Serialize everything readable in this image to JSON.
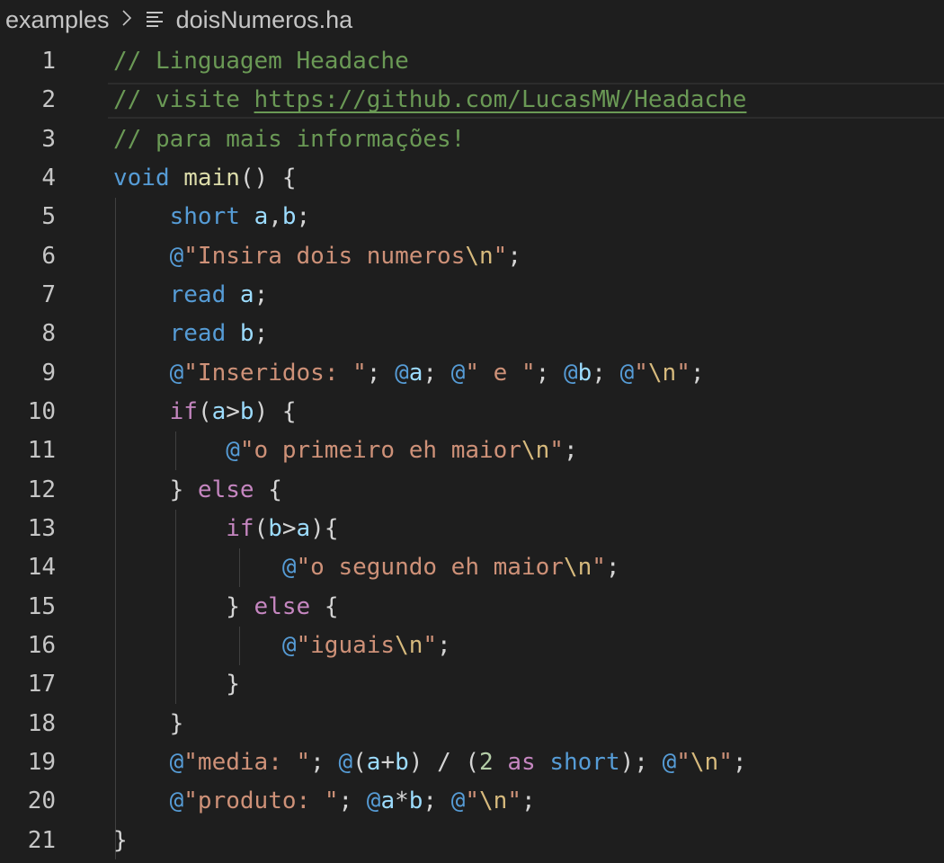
{
  "breadcrumb": {
    "folder": "examples",
    "separator": ">",
    "file_icon": "lines-file-icon",
    "file": "doisNumeros.ha"
  },
  "editor": {
    "current_line": 2,
    "lines": [
      {
        "n": "1",
        "tokens": [
          {
            "t": "// Linguagem Headache",
            "c": "comment"
          }
        ]
      },
      {
        "n": "2",
        "tokens": [
          {
            "t": "// visite ",
            "c": "comment"
          },
          {
            "t": "https://github.com/LucasMW/Headache",
            "c": "link"
          }
        ]
      },
      {
        "n": "3",
        "tokens": [
          {
            "t": "// para mais informações!",
            "c": "comment"
          }
        ]
      },
      {
        "n": "4",
        "tokens": [
          {
            "t": "void",
            "c": "keyword"
          },
          {
            "t": " ",
            "c": "punct"
          },
          {
            "t": "main",
            "c": "function"
          },
          {
            "t": "() {",
            "c": "punct"
          }
        ]
      },
      {
        "n": "5",
        "tokens": [
          {
            "t": "    ",
            "c": "punct"
          },
          {
            "t": "short",
            "c": "keyword"
          },
          {
            "t": " ",
            "c": "punct"
          },
          {
            "t": "a",
            "c": "var"
          },
          {
            "t": ",",
            "c": "punct"
          },
          {
            "t": "b",
            "c": "var"
          },
          {
            "t": ";",
            "c": "punct"
          }
        ]
      },
      {
        "n": "6",
        "tokens": [
          {
            "t": "    ",
            "c": "punct"
          },
          {
            "t": "@",
            "c": "at"
          },
          {
            "t": "\"Insira dois numeros",
            "c": "string"
          },
          {
            "t": "\\n",
            "c": "escape"
          },
          {
            "t": "\"",
            "c": "string"
          },
          {
            "t": ";",
            "c": "punct"
          }
        ]
      },
      {
        "n": "7",
        "tokens": [
          {
            "t": "    ",
            "c": "punct"
          },
          {
            "t": "read",
            "c": "keyword"
          },
          {
            "t": " ",
            "c": "punct"
          },
          {
            "t": "a",
            "c": "var"
          },
          {
            "t": ";",
            "c": "punct"
          }
        ]
      },
      {
        "n": "8",
        "tokens": [
          {
            "t": "    ",
            "c": "punct"
          },
          {
            "t": "read",
            "c": "keyword"
          },
          {
            "t": " ",
            "c": "punct"
          },
          {
            "t": "b",
            "c": "var"
          },
          {
            "t": ";",
            "c": "punct"
          }
        ]
      },
      {
        "n": "9",
        "tokens": [
          {
            "t": "    ",
            "c": "punct"
          },
          {
            "t": "@",
            "c": "at"
          },
          {
            "t": "\"Inseridos: \"",
            "c": "string"
          },
          {
            "t": "; ",
            "c": "punct"
          },
          {
            "t": "@",
            "c": "at"
          },
          {
            "t": "a",
            "c": "var"
          },
          {
            "t": "; ",
            "c": "punct"
          },
          {
            "t": "@",
            "c": "at"
          },
          {
            "t": "\" e \"",
            "c": "string"
          },
          {
            "t": "; ",
            "c": "punct"
          },
          {
            "t": "@",
            "c": "at"
          },
          {
            "t": "b",
            "c": "var"
          },
          {
            "t": "; ",
            "c": "punct"
          },
          {
            "t": "@",
            "c": "at"
          },
          {
            "t": "\"",
            "c": "string"
          },
          {
            "t": "\\n",
            "c": "escape"
          },
          {
            "t": "\"",
            "c": "string"
          },
          {
            "t": ";",
            "c": "punct"
          }
        ]
      },
      {
        "n": "10",
        "tokens": [
          {
            "t": "    ",
            "c": "punct"
          },
          {
            "t": "if",
            "c": "control"
          },
          {
            "t": "(",
            "c": "punct"
          },
          {
            "t": "a",
            "c": "var"
          },
          {
            "t": ">",
            "c": "punct"
          },
          {
            "t": "b",
            "c": "var"
          },
          {
            "t": ") {",
            "c": "punct"
          }
        ]
      },
      {
        "n": "11",
        "tokens": [
          {
            "t": "        ",
            "c": "punct"
          },
          {
            "t": "@",
            "c": "at"
          },
          {
            "t": "\"o primeiro eh maior",
            "c": "string"
          },
          {
            "t": "\\n",
            "c": "escape"
          },
          {
            "t": "\"",
            "c": "string"
          },
          {
            "t": ";",
            "c": "punct"
          }
        ]
      },
      {
        "n": "12",
        "tokens": [
          {
            "t": "    } ",
            "c": "punct"
          },
          {
            "t": "else",
            "c": "control"
          },
          {
            "t": " {",
            "c": "punct"
          }
        ]
      },
      {
        "n": "13",
        "tokens": [
          {
            "t": "        ",
            "c": "punct"
          },
          {
            "t": "if",
            "c": "control"
          },
          {
            "t": "(",
            "c": "punct"
          },
          {
            "t": "b",
            "c": "var"
          },
          {
            "t": ">",
            "c": "punct"
          },
          {
            "t": "a",
            "c": "var"
          },
          {
            "t": "){",
            "c": "punct"
          }
        ]
      },
      {
        "n": "14",
        "tokens": [
          {
            "t": "            ",
            "c": "punct"
          },
          {
            "t": "@",
            "c": "at"
          },
          {
            "t": "\"o segundo eh maior",
            "c": "string"
          },
          {
            "t": "\\n",
            "c": "escape"
          },
          {
            "t": "\"",
            "c": "string"
          },
          {
            "t": ";",
            "c": "punct"
          }
        ]
      },
      {
        "n": "15",
        "tokens": [
          {
            "t": "        } ",
            "c": "punct"
          },
          {
            "t": "else",
            "c": "control"
          },
          {
            "t": " {",
            "c": "punct"
          }
        ]
      },
      {
        "n": "16",
        "tokens": [
          {
            "t": "            ",
            "c": "punct"
          },
          {
            "t": "@",
            "c": "at"
          },
          {
            "t": "\"iguais",
            "c": "string"
          },
          {
            "t": "\\n",
            "c": "escape"
          },
          {
            "t": "\"",
            "c": "string"
          },
          {
            "t": ";",
            "c": "punct"
          }
        ]
      },
      {
        "n": "17",
        "tokens": [
          {
            "t": "        }",
            "c": "punct"
          }
        ]
      },
      {
        "n": "18",
        "tokens": [
          {
            "t": "    }",
            "c": "punct"
          }
        ]
      },
      {
        "n": "19",
        "tokens": [
          {
            "t": "    ",
            "c": "punct"
          },
          {
            "t": "@",
            "c": "at"
          },
          {
            "t": "\"media: \"",
            "c": "string"
          },
          {
            "t": "; ",
            "c": "punct"
          },
          {
            "t": "@",
            "c": "at"
          },
          {
            "t": "(",
            "c": "punct"
          },
          {
            "t": "a",
            "c": "var"
          },
          {
            "t": "+",
            "c": "punct"
          },
          {
            "t": "b",
            "c": "var"
          },
          {
            "t": ") / (",
            "c": "punct"
          },
          {
            "t": "2",
            "c": "num"
          },
          {
            "t": " ",
            "c": "punct"
          },
          {
            "t": "as",
            "c": "control"
          },
          {
            "t": " ",
            "c": "punct"
          },
          {
            "t": "short",
            "c": "keyword"
          },
          {
            "t": "); ",
            "c": "punct"
          },
          {
            "t": "@",
            "c": "at"
          },
          {
            "t": "\"",
            "c": "string"
          },
          {
            "t": "\\n",
            "c": "escape"
          },
          {
            "t": "\"",
            "c": "string"
          },
          {
            "t": ";",
            "c": "punct"
          }
        ]
      },
      {
        "n": "20",
        "tokens": [
          {
            "t": "    ",
            "c": "punct"
          },
          {
            "t": "@",
            "c": "at"
          },
          {
            "t": "\"produto: \"",
            "c": "string"
          },
          {
            "t": "; ",
            "c": "punct"
          },
          {
            "t": "@",
            "c": "at"
          },
          {
            "t": "a",
            "c": "var"
          },
          {
            "t": "*",
            "c": "punct"
          },
          {
            "t": "b",
            "c": "var"
          },
          {
            "t": "; ",
            "c": "punct"
          },
          {
            "t": "@",
            "c": "at"
          },
          {
            "t": "\"",
            "c": "string"
          },
          {
            "t": "\\n",
            "c": "escape"
          },
          {
            "t": "\"",
            "c": "string"
          },
          {
            "t": ";",
            "c": "punct"
          }
        ]
      },
      {
        "n": "21",
        "tokens": [
          {
            "t": "}",
            "c": "punct"
          }
        ]
      }
    ]
  }
}
